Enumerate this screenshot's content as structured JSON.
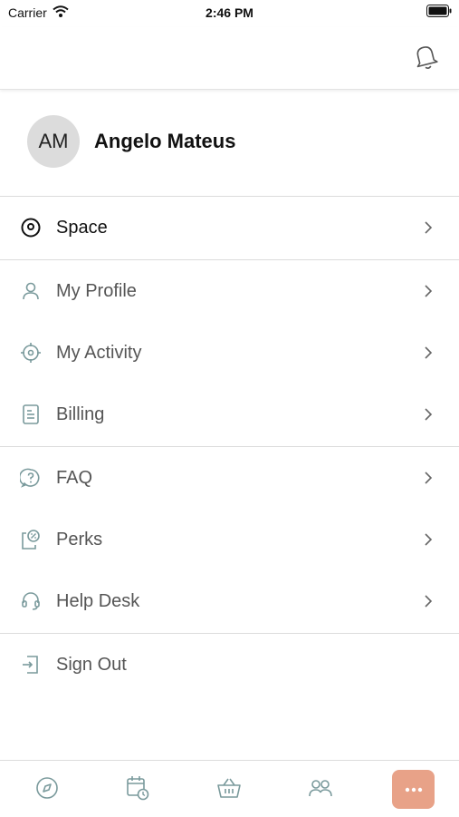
{
  "status_bar": {
    "carrier": "Carrier",
    "time": "2:46 PM"
  },
  "profile": {
    "initials": "AM",
    "name": "Angelo Mateus"
  },
  "menu": {
    "space": "Space",
    "my_profile": "My Profile",
    "my_activity": "My Activity",
    "billing": "Billing",
    "faq": "FAQ",
    "perks": "Perks",
    "help_desk": "Help Desk",
    "sign_out": "Sign Out"
  },
  "icons": {
    "header": "bell-icon",
    "space": "location-pin-icon",
    "my_profile": "user-icon",
    "my_activity": "crosshair-icon",
    "billing": "document-icon",
    "faq": "help-bubble-icon",
    "perks": "discount-tag-icon",
    "help_desk": "headset-icon",
    "sign_out": "sign-out-icon",
    "tabs": [
      "compass-icon",
      "calendar-clock-icon",
      "basket-icon",
      "people-icon",
      "more-icon"
    ]
  },
  "colors": {
    "accent": "#e8a288",
    "icon": "#7a9a9c",
    "divider": "#dcdcdc"
  }
}
